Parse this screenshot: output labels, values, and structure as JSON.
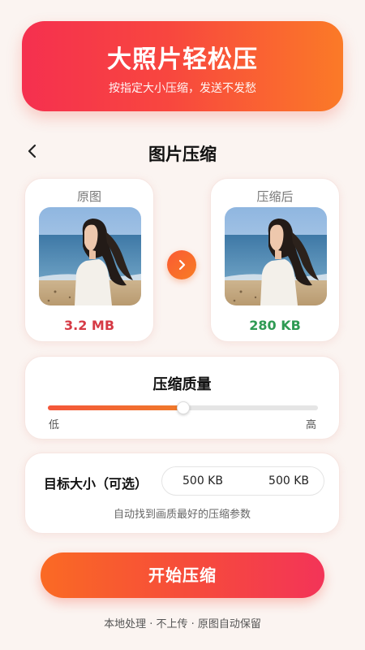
{
  "banner": {
    "title": "大照片轻松压",
    "subtitle": "按指定大小压缩，发送不发愁"
  },
  "nav": {
    "back_icon": "chevron-left-icon",
    "title": "图片压缩"
  },
  "original": {
    "label": "原图",
    "size": "3.2 MB",
    "size_color": "#d63a45"
  },
  "compressed": {
    "label": "压缩后",
    "size": "280 KB",
    "size_color": "#2e9a53"
  },
  "arrow_icon": "chevron-right-icon",
  "quality": {
    "title": "压缩质量",
    "value": 0.5,
    "low_label": "低",
    "high_label": "高"
  },
  "target": {
    "label": "目标大小（可选）",
    "value_1": "500 KB",
    "value_2": "500 KB",
    "hint": "自动找到画质最好的压缩参数"
  },
  "start_button": "开始压缩",
  "footer": "本地处理 · 不上传 · 原图自动保留",
  "colors": {
    "accent_start": "#f5304f",
    "accent_end": "#fb7a27",
    "background": "#fbf4f1"
  }
}
